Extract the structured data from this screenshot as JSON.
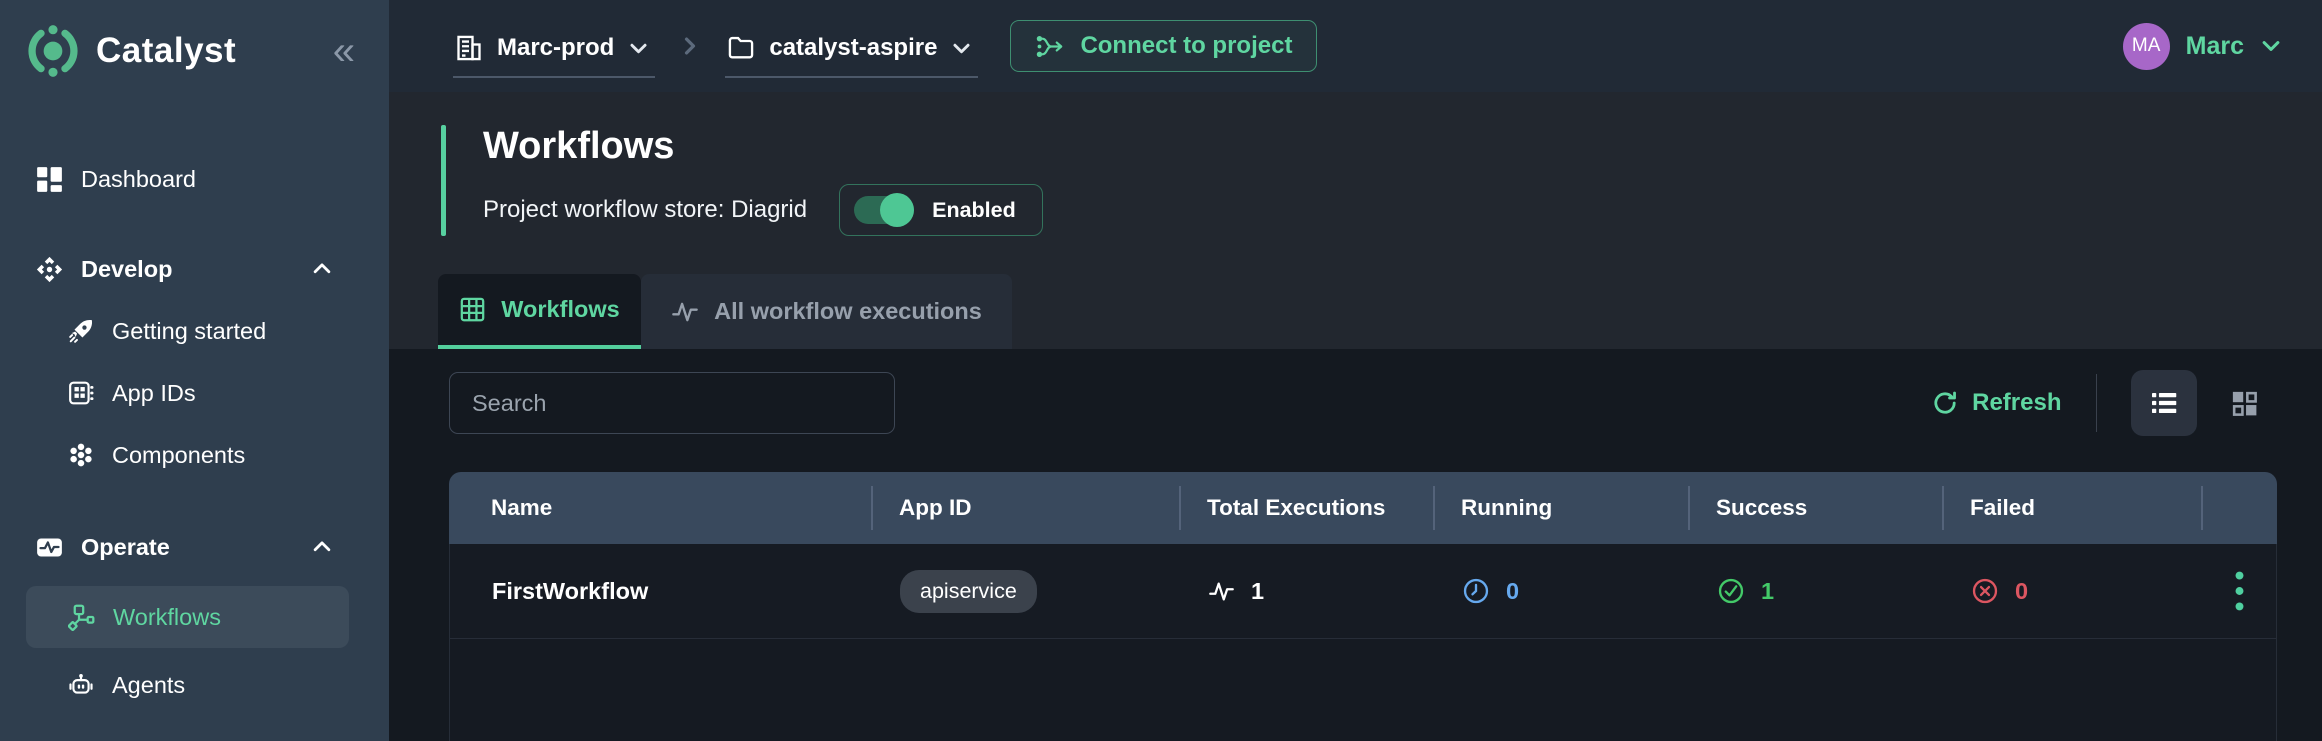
{
  "sidebar": {
    "logo_text": "Catalyst",
    "collapse_icon": "chevrons-left-icon",
    "items": [
      {
        "label": "Dashboard",
        "icon": "dashboard-icon"
      },
      {
        "label": "Develop",
        "icon": "develop-icon",
        "type": "section",
        "expanded": true
      },
      {
        "label": "Getting started",
        "icon": "rocket-icon"
      },
      {
        "label": "App IDs",
        "icon": "app-ids-icon"
      },
      {
        "label": "Components",
        "icon": "components-icon"
      },
      {
        "label": "Operate",
        "icon": "operate-icon",
        "type": "section",
        "expanded": true
      },
      {
        "label": "Workflows",
        "icon": "workflow-icon",
        "active": true
      },
      {
        "label": "Agents",
        "icon": "robot-icon"
      }
    ]
  },
  "topbar": {
    "org": {
      "label": "Marc-prod",
      "icon": "organization-icon"
    },
    "project": {
      "label": "catalyst-aspire",
      "icon": "folder-icon"
    },
    "connect_button": "Connect to project",
    "user": {
      "initials": "MA",
      "name": "Marc"
    }
  },
  "page": {
    "title": "Workflows",
    "store_label": "Project workflow store: Diagrid",
    "store_toggle": {
      "label": "Enabled",
      "state": "on"
    }
  },
  "tabs": [
    {
      "label": "Workflows",
      "icon": "table-grid-icon",
      "active": true
    },
    {
      "label": "All workflow executions",
      "icon": "pulse-icon",
      "active": false
    }
  ],
  "toolbar": {
    "search_placeholder": "Search",
    "refresh_label": "Refresh",
    "view_mode": "list"
  },
  "table": {
    "columns": [
      "Name",
      "App ID",
      "Total Executions",
      "Running",
      "Success",
      "Failed"
    ],
    "rows": [
      {
        "name": "FirstWorkflow",
        "app_id": "apiservice",
        "total_executions": "1",
        "running": "0",
        "success": "1",
        "failed": "0"
      }
    ]
  },
  "colors": {
    "accent_green": "#5fd6a1",
    "sidebar_bg": "#2f3e4e",
    "panel_bg": "#141920",
    "table_header_bg": "#39495d",
    "running_blue": "#66a9ee",
    "success_green": "#43c968",
    "failed_red": "#dc5661",
    "avatar_purple": "#a767c8"
  }
}
